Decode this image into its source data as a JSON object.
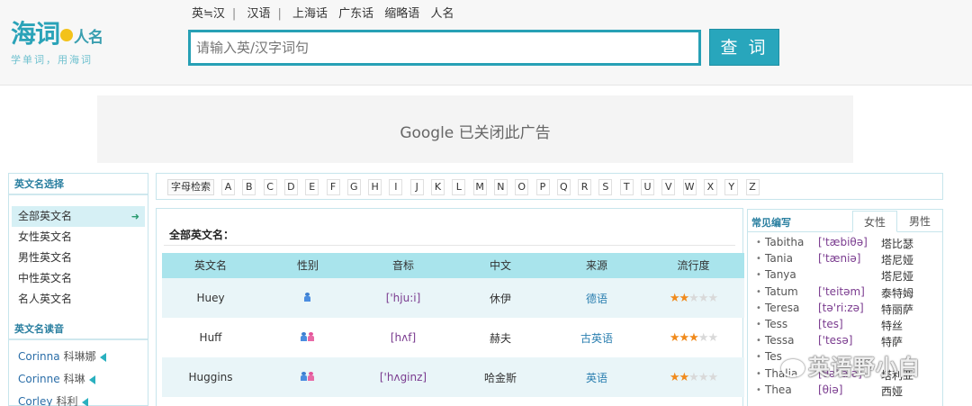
{
  "logo": {
    "title": "海词",
    "title_small": "人名",
    "subtitle": "学单词，用海词"
  },
  "topnav": [
    "英≒汉",
    "汉语",
    "上海话",
    "广东话",
    "缩略语",
    "人名"
  ],
  "search": {
    "placeholder": "请输入英/汉字词句",
    "button": "查 词"
  },
  "ad": {
    "text": "Google 已关闭此广告"
  },
  "sidebar": {
    "section1_title": "英文名选择",
    "items": [
      "全部英文名",
      "女性英文名",
      "男性英文名",
      "中性英文名",
      "名人英文名"
    ],
    "active_arrow": "➜",
    "section2_title": "英文名读音",
    "names": [
      {
        "en": "Corinna",
        "cn": "科琳娜"
      },
      {
        "en": "Corinne",
        "cn": "科琳"
      },
      {
        "en": "Corley",
        "cn": "科利"
      }
    ]
  },
  "alphabet": {
    "label": "字母检索",
    "letters": [
      "A",
      "B",
      "C",
      "D",
      "E",
      "F",
      "G",
      "H",
      "I",
      "J",
      "K",
      "L",
      "M",
      "N",
      "O",
      "P",
      "Q",
      "R",
      "S",
      "T",
      "U",
      "V",
      "W",
      "X",
      "Y",
      "Z"
    ]
  },
  "main": {
    "title": "全部英文名：",
    "headers": [
      "英文名",
      "性别",
      "音标",
      "中文",
      "来源",
      "流行度"
    ],
    "rows": [
      {
        "name": "Huey",
        "gender": "male",
        "phonetic": "['hju:i]",
        "chinese": "休伊",
        "origin": "德语",
        "popularity": 2
      },
      {
        "name": "Huff",
        "gender": "both",
        "phonetic": "[hʌf]",
        "chinese": "赫夫",
        "origin": "古英语",
        "popularity": 3
      },
      {
        "name": "Huggins",
        "gender": "both",
        "phonetic": "['hʌginz]",
        "chinese": "哈金斯",
        "origin": "英语",
        "popularity": 2
      }
    ]
  },
  "right": {
    "title": "常见编写",
    "tabs": [
      "女性",
      "男性"
    ],
    "active_tab": "女性",
    "rows": [
      {
        "en": "Tabitha",
        "ph": "['tæbiθə]",
        "cn": "塔比瑟"
      },
      {
        "en": "Tania",
        "ph": "['tæniə]",
        "cn": "塔尼娅"
      },
      {
        "en": "Tanya",
        "ph": "",
        "cn": "塔尼娅"
      },
      {
        "en": "Tatum",
        "ph": "['teitəm]",
        "cn": "泰特姆"
      },
      {
        "en": "Teresa",
        "ph": "[tə'ri:zə]",
        "cn": "特丽萨"
      },
      {
        "en": "Tess",
        "ph": "[tes]",
        "cn": "特丝"
      },
      {
        "en": "Tessa",
        "ph": "['tesə]",
        "cn": "特萨"
      },
      {
        "en": "Tes",
        "ph": "",
        "cn": ""
      },
      {
        "en": "Thalia",
        "ph": "[θə'laiə]",
        "cn": "塔利亚"
      },
      {
        "en": "Thea",
        "ph": "[θiə]",
        "cn": "西娅"
      }
    ]
  },
  "watermark": "英语野小白",
  "colors": {
    "accent": "#28a6bc",
    "header_bg": "#a9e4ec",
    "star": "#f08a1c"
  }
}
